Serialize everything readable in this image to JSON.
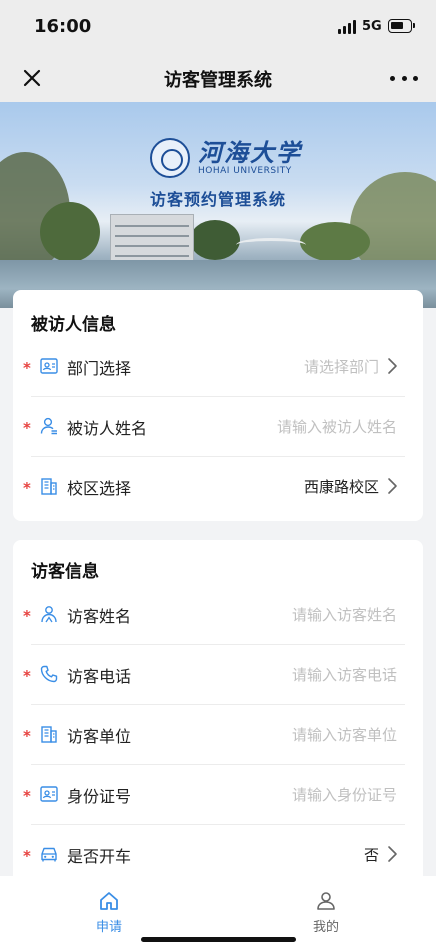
{
  "status_bar": {
    "time": "16:00",
    "network": "5G"
  },
  "nav": {
    "title": "访客管理系统"
  },
  "banner": {
    "university_cn": "河海大学",
    "university_en": "HOHAI UNIVERSITY",
    "system_name": "访客预约管理系统"
  },
  "host_section": {
    "title": "被访人信息",
    "fields": [
      {
        "icon": "id-card-icon",
        "label": "部门选择",
        "value": "请选择部门",
        "kind": "select",
        "filled": false
      },
      {
        "icon": "user-icon",
        "label": "被访人姓名",
        "value": "请输入被访人姓名",
        "kind": "input",
        "filled": false
      },
      {
        "icon": "building-icon",
        "label": "校区选择",
        "value": "西康路校区",
        "kind": "select",
        "filled": true
      }
    ]
  },
  "visitor_section": {
    "title": "访客信息",
    "fields": [
      {
        "icon": "visitor-icon",
        "label": "访客姓名",
        "value": "请输入访客姓名",
        "kind": "input",
        "filled": false
      },
      {
        "icon": "phone-icon",
        "label": "访客电话",
        "value": "请输入访客电话",
        "kind": "input",
        "filled": false
      },
      {
        "icon": "building-icon",
        "label": "访客单位",
        "value": "请输入访客单位",
        "kind": "input",
        "filled": false
      },
      {
        "icon": "id-card-icon",
        "label": "身份证号",
        "value": "请输入身份证号",
        "kind": "input",
        "filled": false
      },
      {
        "icon": "car-icon",
        "label": "是否开车",
        "value": "否",
        "kind": "select",
        "filled": true
      }
    ]
  },
  "required_mark": "*",
  "tabs": [
    {
      "label": "申请",
      "icon": "home-icon",
      "active": true
    },
    {
      "label": "我的",
      "icon": "profile-icon",
      "active": false
    }
  ],
  "colors": {
    "accent": "#3a8ee6",
    "required": "#e64340",
    "icon": "#3a8ee6",
    "placeholder": "#c0c0c0"
  }
}
